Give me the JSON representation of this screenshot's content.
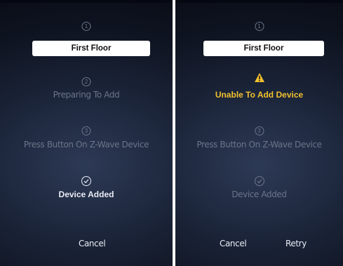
{
  "left": {
    "floor": "First Floor",
    "steps": [
      {
        "num": "1"
      },
      {
        "num": "2",
        "label": "Preparing To Add"
      },
      {
        "num": "3",
        "label": "Press Button On Z-Wave Device"
      },
      {
        "label": "Device Added"
      }
    ],
    "cancel": "Cancel"
  },
  "right": {
    "floor": "First Floor",
    "steps": [
      {
        "num": "1"
      },
      {
        "label": "Unable To Add Device"
      },
      {
        "num": "3",
        "label": "Press Button On Z-Wave Device"
      },
      {
        "label": "Device Added"
      }
    ],
    "cancel": "Cancel",
    "retry": "Retry"
  },
  "colors": {
    "warning": "#f2c12e",
    "dim": "#6b7488"
  },
  "icons": [
    "check-circle-icon",
    "warning-triangle-icon"
  ]
}
